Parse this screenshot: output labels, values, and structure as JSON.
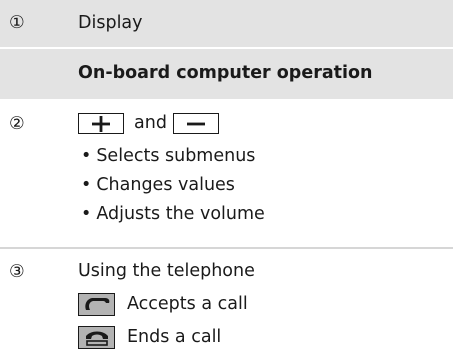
{
  "rows": [
    {
      "number": "①",
      "text": "Display"
    },
    {
      "header": "On-board computer operation"
    },
    {
      "number": "②",
      "plus_key": "+",
      "connector": "and",
      "minus_key": "−",
      "bullet_symbol": "•",
      "bullets": [
        "Selects submenus",
        "Changes values",
        "Adjusts the volume"
      ]
    },
    {
      "number": "③",
      "text": "Using the telephone",
      "actions": [
        {
          "icon": "phone-accept-icon",
          "label": "Accepts a call"
        },
        {
          "icon": "phone-end-icon",
          "label": "Ends a call"
        }
      ]
    }
  ],
  "colors": {
    "shaded_row": "#e3e3e3",
    "icon_fill": "#b3b3b3",
    "text": "#1a1a1a"
  }
}
